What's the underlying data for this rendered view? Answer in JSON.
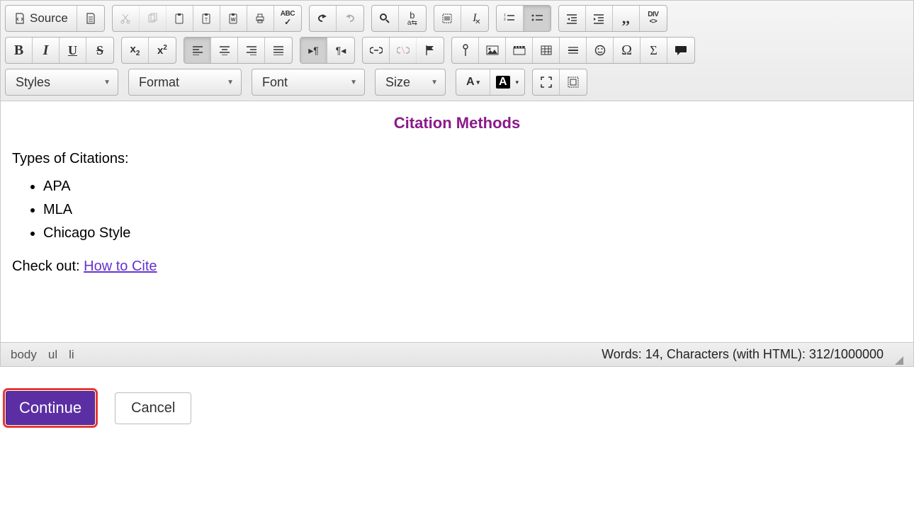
{
  "toolbar": {
    "source_label": "Source",
    "styles_label": "Styles",
    "format_label": "Format",
    "font_label": "Font",
    "size_label": "Size"
  },
  "content": {
    "title": "Citation Methods",
    "intro": "Types of Citations:",
    "items": [
      "APA",
      "MLA",
      "Chicago Style"
    ],
    "outro_prefix": "Check out: ",
    "outro_link": "How to Cite"
  },
  "status": {
    "path": [
      "body",
      "ul",
      "li"
    ],
    "words_label": "Words:",
    "words": 14,
    "chars_label": "Characters (with HTML):",
    "chars": 312,
    "char_limit": 1000000
  },
  "actions": {
    "continue_label": "Continue",
    "cancel_label": "Cancel"
  }
}
